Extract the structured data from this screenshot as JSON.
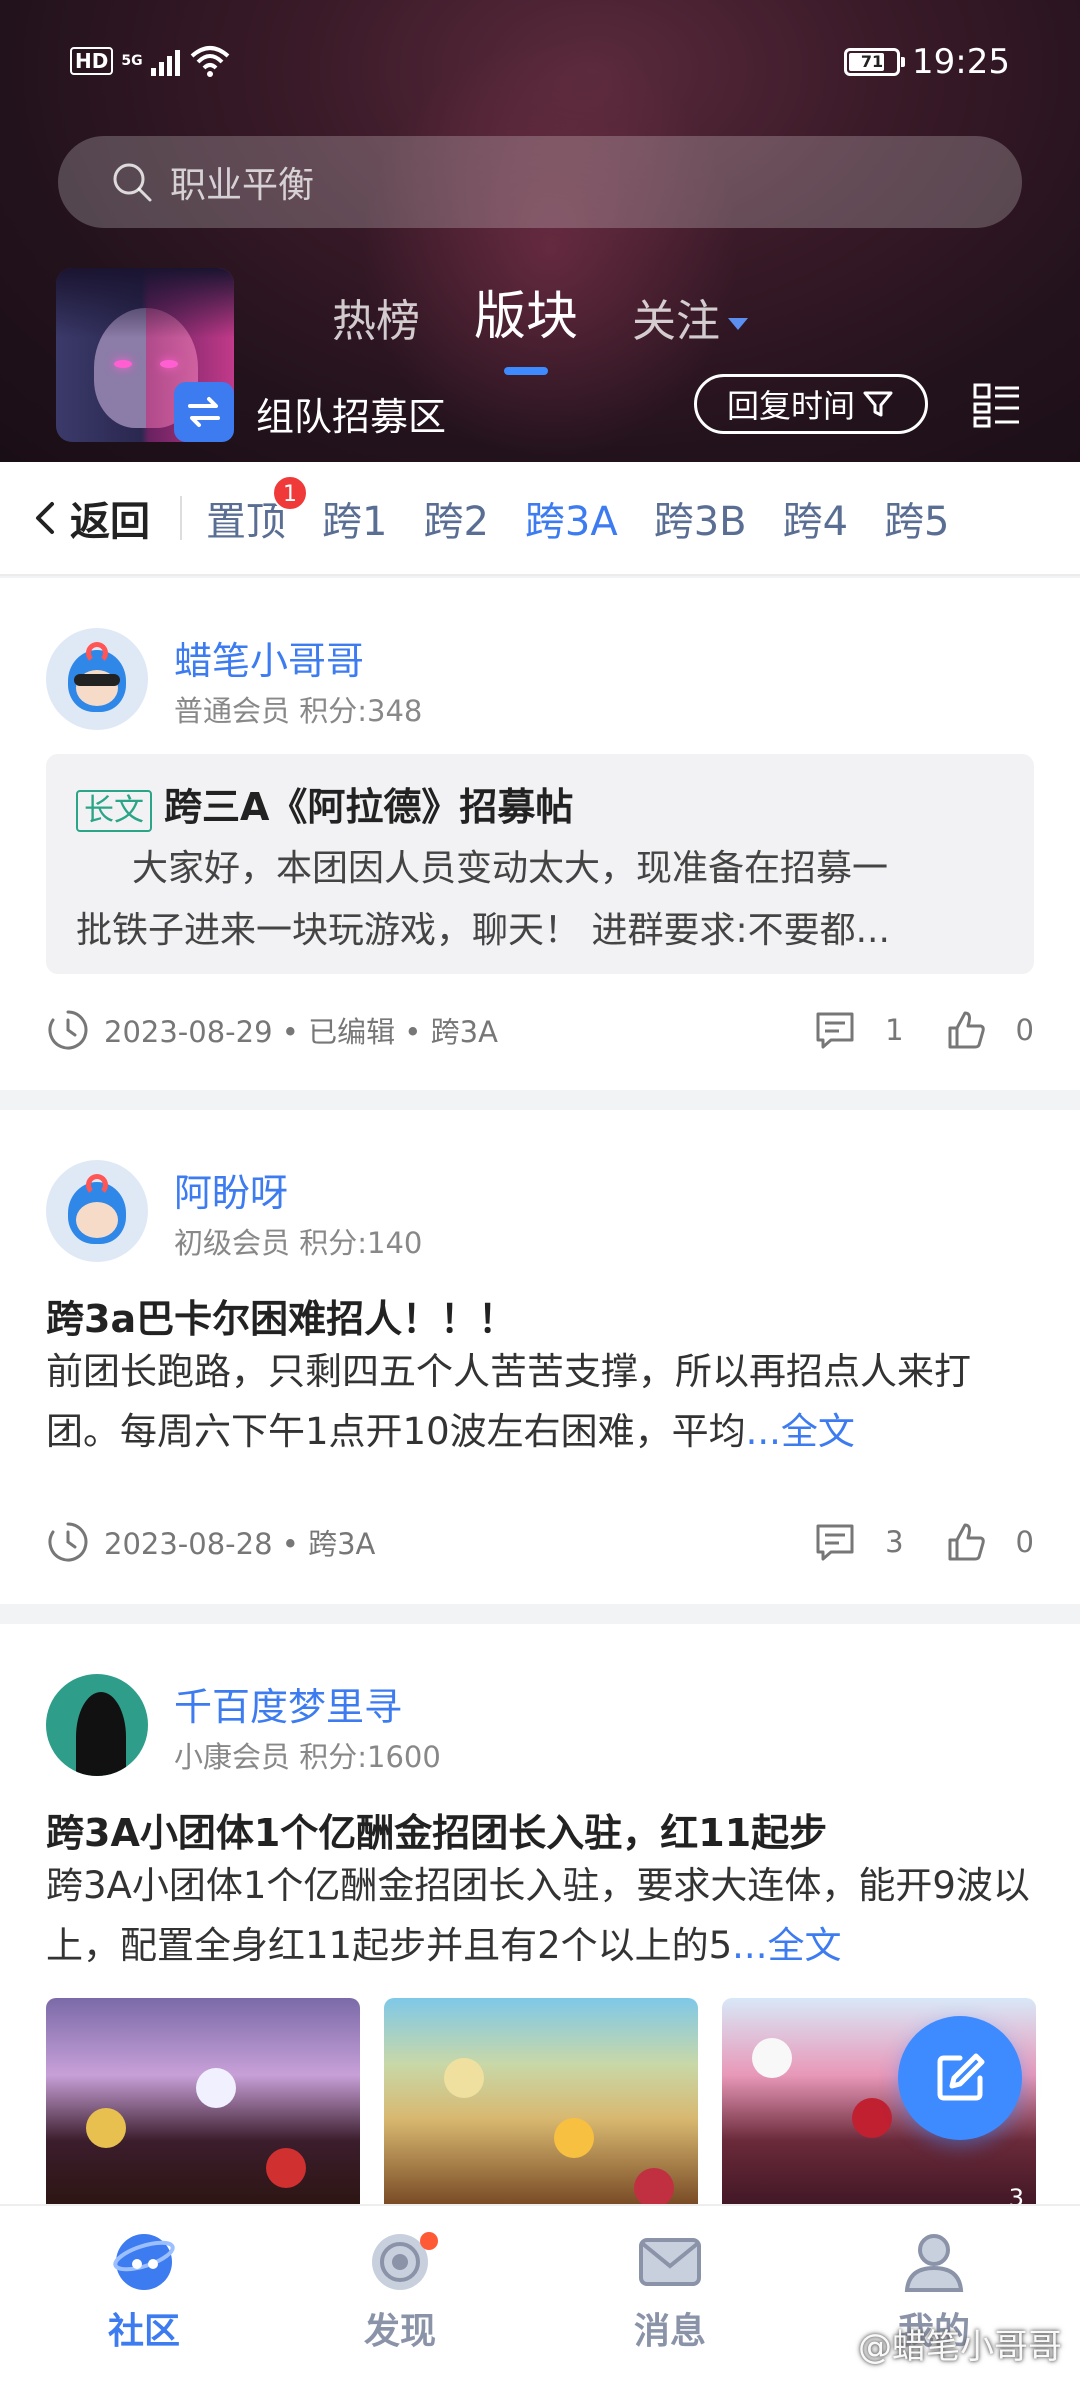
{
  "status_bar": {
    "network": "HD",
    "network_type": "5G",
    "battery": "71",
    "time": "19:25"
  },
  "search": {
    "placeholder": "职业平衡"
  },
  "header": {
    "tabs": [
      {
        "label": "热榜",
        "active": false
      },
      {
        "label": "版块",
        "active": true
      },
      {
        "label": "关注",
        "active": false
      }
    ],
    "board_name": "组队招募区",
    "sort_label": "回复时间"
  },
  "subnav": {
    "back_label": "返回",
    "categories": [
      {
        "label": "置顶",
        "badge": "1"
      },
      {
        "label": "跨1"
      },
      {
        "label": "跨2"
      },
      {
        "label": "跨3A",
        "active": true
      },
      {
        "label": "跨3B"
      },
      {
        "label": "跨4"
      },
      {
        "label": "跨5"
      }
    ]
  },
  "posts": [
    {
      "username": "蜡笔小哥哥",
      "level": "普通会员 积分:348",
      "tag": "长文",
      "title": "跨三A《阿拉德》招募帖",
      "body_line1": "大家好，本团因人员变动太大，现准备在招募一",
      "body_line2": "批铁子进来一块玩游戏，聊天！    进群要求:不要都...",
      "meta": "2023-08-29 • 已编辑 • 跨3A",
      "comments": "1",
      "likes": "0"
    },
    {
      "username": "阿盼呀",
      "level": "初级会员 积分:140",
      "title": "跨3a巴卡尔困难招人！！！",
      "body": "前团长跑路，只剩四五个人苦苦支撑，所以再招点人来打团。每周六下午1点开10波左右困难，平均",
      "more": "...全文",
      "meta": "2023-08-28 • 跨3A",
      "comments": "3",
      "likes": "0"
    },
    {
      "username": "千百度梦里寻",
      "level": "小康会员 积分:1600",
      "title": "跨3A小团体1个亿酬金招团长入驻，红11起步",
      "body": " 跨3A小团体1个亿酬金招团长入驻，要求大连体，能开9波以上，配置全身红11起步并且有2个以上的5",
      "more": "...全文",
      "image_count": "3"
    }
  ],
  "bottom_nav": [
    {
      "label": "社区",
      "icon": "community-icon",
      "active": true
    },
    {
      "label": "发现",
      "icon": "discover-icon",
      "active": false,
      "dot": true
    },
    {
      "label": "消息",
      "icon": "message-icon",
      "active": false
    },
    {
      "label": "我的",
      "icon": "profile-icon",
      "active": false
    }
  ],
  "watermark": "@蜡笔小哥哥",
  "colors": {
    "accent": "#3d7bf0",
    "badge": "#f03a3a",
    "tag": "#2aa588",
    "fab": "#3d8bff"
  }
}
